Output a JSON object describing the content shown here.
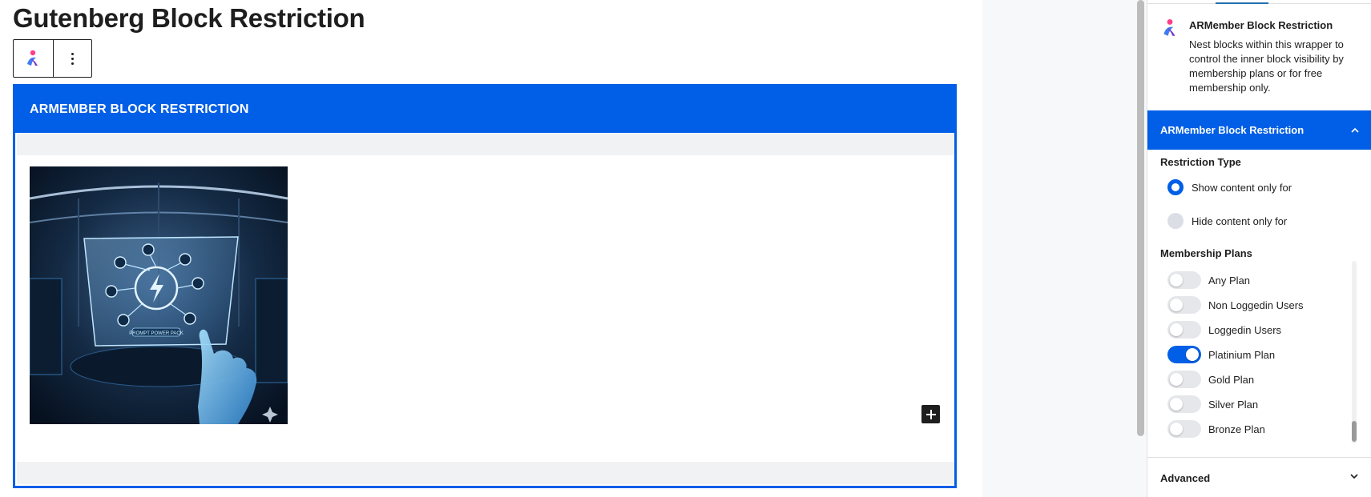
{
  "page": {
    "title": "Gutenberg Block Restriction"
  },
  "block": {
    "header_label": "ARMEMBER BLOCK RESTRICTION",
    "image_text": "PROMPT POWER PACK"
  },
  "sidebar": {
    "plugin_name": "ARMember Block Restriction",
    "plugin_description": "Nest blocks within this wrapper to control the inner block visibility by membership plans or for free membership only.",
    "panel_title": "ARMember Block Restriction",
    "restriction_type_label": "Restriction Type",
    "restriction_options": [
      {
        "label": "Show content only for",
        "selected": true
      },
      {
        "label": "Hide content only for",
        "selected": false
      }
    ],
    "membership_plans_label": "Membership Plans",
    "plans": [
      {
        "label": "Any Plan",
        "enabled": false
      },
      {
        "label": "Non Loggedin Users",
        "enabled": false
      },
      {
        "label": "Loggedin Users",
        "enabled": false
      },
      {
        "label": "Platinium Plan",
        "enabled": true
      },
      {
        "label": "Gold Plan",
        "enabled": false
      },
      {
        "label": "Silver Plan",
        "enabled": false
      },
      {
        "label": "Bronze Plan",
        "enabled": false
      }
    ],
    "advanced_label": "Advanced"
  },
  "colors": {
    "accent": "#005fe6",
    "text": "#1e1e1e",
    "toggle_off": "#e6e7ea"
  },
  "icons": {
    "plugin": "armember-person-icon",
    "more": "kebab-menu-icon",
    "add": "plus-icon",
    "collapse": "chevron-up-icon",
    "expand": "chevron-down-icon"
  }
}
